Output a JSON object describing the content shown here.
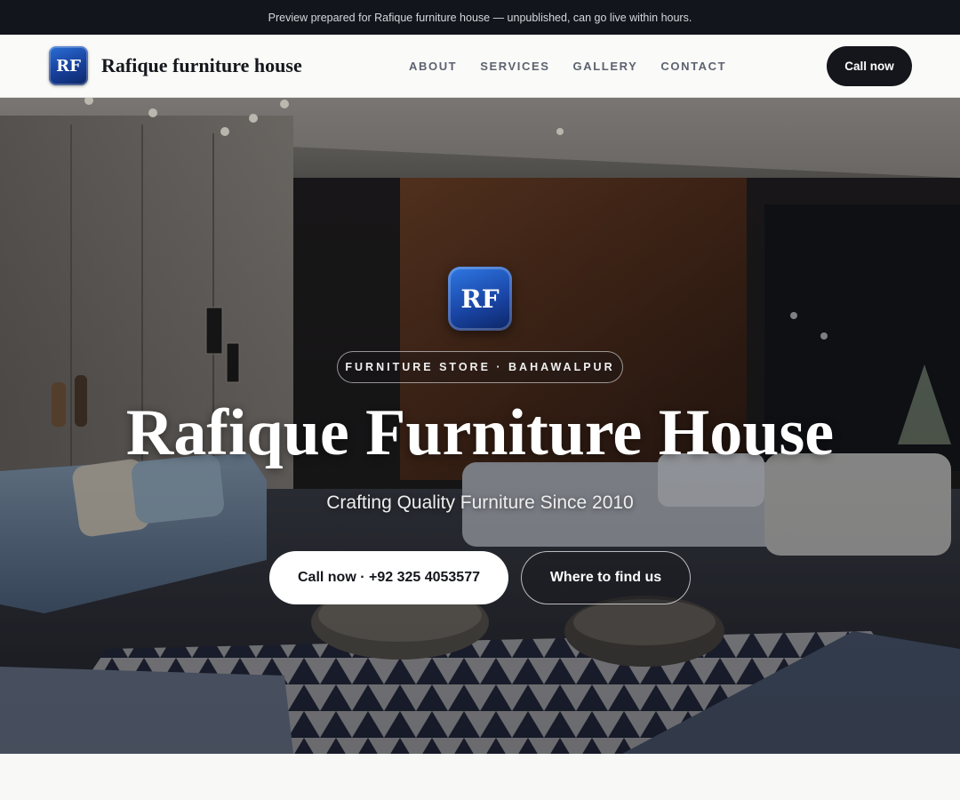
{
  "preview_banner": "Preview prepared for Rafique furniture house — unpublished, can go live within hours.",
  "brand": {
    "logo_initials": "RF",
    "name": "Rafique furniture house"
  },
  "nav": {
    "items": [
      {
        "label": "ABOUT"
      },
      {
        "label": "SERVICES"
      },
      {
        "label": "GALLERY"
      },
      {
        "label": "CONTACT"
      }
    ],
    "cta_label": "Call now"
  },
  "hero": {
    "logo_initials": "RF",
    "eyebrow": "FURNITURE STORE · BAHAWALPUR",
    "title": "Rafique Furniture House",
    "subtitle": "Crafting Quality Furniture Since 2010",
    "primary_button": "Call now · +92 325 4053577",
    "secondary_button": "Where to find us",
    "background_image": "furniture-showroom-photo"
  },
  "colors": {
    "dark": "#14161b",
    "topbar": "#12151b",
    "logo_blue": "#1a47a8",
    "page_bg": "#f8f8f6"
  }
}
